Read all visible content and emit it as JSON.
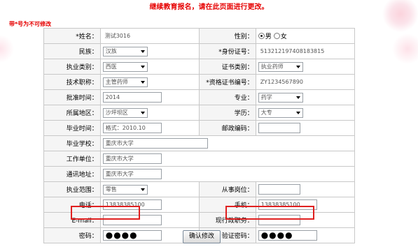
{
  "notice": "继续教育报名，请在此页面进行更改。",
  "required_note": "带*号为不可修改",
  "fields": {
    "name": {
      "label": "*姓名：",
      "value": "测试3016"
    },
    "gender": {
      "label": "性别：",
      "options": [
        "男",
        "女"
      ],
      "selected": "男"
    },
    "ethnicity": {
      "label": "民族：",
      "value": "汉族"
    },
    "id_number": {
      "label": "*身份证号：",
      "value": "513212197408183815"
    },
    "practice_category": {
      "label": "执业类别：",
      "value": "西医"
    },
    "certificate_category": {
      "label": "证书类别：",
      "value": "执业药师"
    },
    "technical_title": {
      "label": "技术职称：",
      "value": "主管药师"
    },
    "qualification_number": {
      "label": "*资格证书编号：",
      "value": "ZY1234567890"
    },
    "approval_time": {
      "label": "批准时间：",
      "value": "2014"
    },
    "major": {
      "label": "专业：",
      "value": "药学"
    },
    "region": {
      "label": "所属地区：",
      "value": "沙坪坝区"
    },
    "education": {
      "label": "学历：",
      "value": "大专"
    },
    "graduation_time": {
      "label": "毕业时间：",
      "value": "格式：2010.10"
    },
    "postal_code": {
      "label": "邮政编码：",
      "value": ""
    },
    "graduation_school": {
      "label": "毕业学校：",
      "value": "重庆市大学"
    },
    "work_unit": {
      "label": "工作单位：",
      "value": "重庆市大学"
    },
    "address": {
      "label": "通讯地址：",
      "value": "重庆市大学"
    },
    "practice_scope": {
      "label": "执业范围：",
      "value": "零售"
    },
    "current_position": {
      "label": "从事岗位：",
      "value": ""
    },
    "phone": {
      "label": "电话：",
      "value": "13838385100"
    },
    "mobile": {
      "label": "手机：",
      "value": "13838385100"
    },
    "email": {
      "label": "E-mail：",
      "value": ""
    },
    "admin_post": {
      "label": "现行政职务：",
      "value": ""
    },
    "password": {
      "label": "密码：",
      "value": "●●●●"
    },
    "verify_password": {
      "label": "验证密码：",
      "value": "●●●●"
    }
  },
  "submit_label": "确认修改",
  "colors": {
    "notice": "#e60000",
    "highlight": "#e02020",
    "label_bg": "#f5f5f5",
    "border": "#c8c8c8"
  }
}
